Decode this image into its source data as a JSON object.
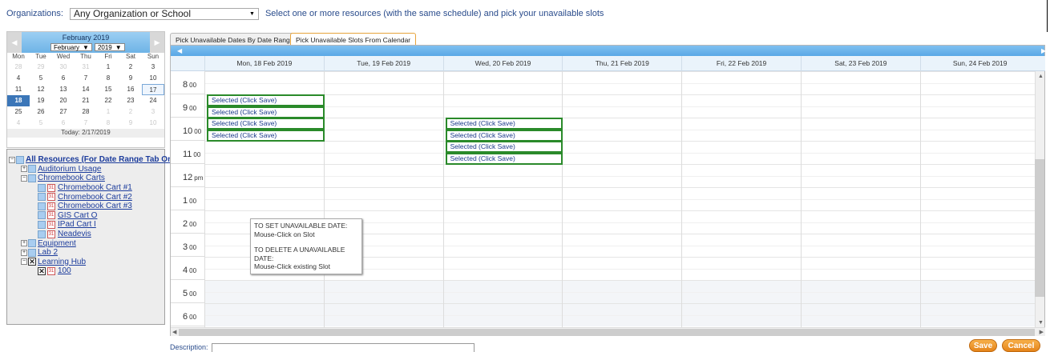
{
  "topbar": {
    "org_label": "Organizations:",
    "org_value": "Any Organization or School",
    "hint": "Select one or more resources (with the same schedule) and pick your unavailable slots"
  },
  "minical": {
    "title": "February 2019",
    "month_select": "February",
    "year_select": "2019",
    "dow": [
      "Mon",
      "Tue",
      "Wed",
      "Thu",
      "Fri",
      "Sat",
      "Sun"
    ],
    "weeks": [
      [
        "28",
        "29",
        "30",
        "31",
        "1",
        "2",
        "3"
      ],
      [
        "4",
        "5",
        "6",
        "7",
        "8",
        "9",
        "10"
      ],
      [
        "11",
        "12",
        "13",
        "14",
        "15",
        "16",
        "17"
      ],
      [
        "18",
        "19",
        "20",
        "21",
        "22",
        "23",
        "24"
      ],
      [
        "25",
        "26",
        "27",
        "28",
        "1",
        "2",
        "3"
      ],
      [
        "4",
        "5",
        "6",
        "7",
        "8",
        "9",
        "10"
      ]
    ],
    "today_label": "Today: 2/17/2019"
  },
  "tree": {
    "root": "All Resources (For Date Range Tab Only)",
    "groups": [
      {
        "label": "Auditorium Usage",
        "expanded": false,
        "checked": false,
        "items": []
      },
      {
        "label": "Chromebook Carts",
        "expanded": true,
        "checked": false,
        "items": [
          "Chromebook Cart #1",
          "Chromebook Cart #2",
          "Chromebook Cart #3",
          "GIS Cart O",
          "IPad Cart I",
          "Neadevis"
        ]
      },
      {
        "label": "Equipment",
        "expanded": false,
        "checked": false,
        "items": []
      },
      {
        "label": "Lab 2",
        "expanded": false,
        "checked": false,
        "items": []
      },
      {
        "label": "Learning Hub",
        "expanded": true,
        "checked": true,
        "items": [
          "100"
        ]
      }
    ]
  },
  "tabs": {
    "date_range": "Pick Unavailable Dates By Date Range",
    "calendar": "Pick Unavailable Slots From Calendar"
  },
  "scheduler": {
    "days": [
      "Mon, 18 Feb 2019",
      "Tue, 19 Feb 2019",
      "Wed, 20 Feb 2019",
      "Thu, 21 Feb 2019",
      "Fri, 22 Feb 2019",
      "Sat, 23 Feb 2019",
      "Sun, 24 Feb 2019"
    ],
    "hours": [
      {
        "h": "8",
        "s": "00"
      },
      {
        "h": "9",
        "s": "00"
      },
      {
        "h": "10",
        "s": "00"
      },
      {
        "h": "11",
        "s": "00"
      },
      {
        "h": "12",
        "s": "pm"
      },
      {
        "h": "1",
        "s": "00"
      },
      {
        "h": "2",
        "s": "00"
      },
      {
        "h": "3",
        "s": "00"
      },
      {
        "h": "4",
        "s": "00"
      },
      {
        "h": "5",
        "s": "00"
      },
      {
        "h": "6",
        "s": "00"
      }
    ],
    "events": [
      {
        "day": 0,
        "slot": 2,
        "label": "Selected (Click Save)"
      },
      {
        "day": 0,
        "slot": 3,
        "label": "Selected (Click Save)"
      },
      {
        "day": 0,
        "slot": 4,
        "label": "Selected (Click Save)"
      },
      {
        "day": 0,
        "slot": 5,
        "label": "Selected (Click Save)"
      },
      {
        "day": 2,
        "slot": 4,
        "label": "Selected (Click Save)"
      },
      {
        "day": 2,
        "slot": 5,
        "label": "Selected (Click Save)"
      },
      {
        "day": 2,
        "slot": 6,
        "label": "Selected (Click Save)"
      },
      {
        "day": 2,
        "slot": 7,
        "label": "Selected (Click Save)"
      }
    ],
    "tooltip": {
      "line1": "TO SET UNAVAILABLE DATE:",
      "line2": "Mouse-Click on Slot",
      "line3": "TO DELETE A UNAVAILABLE DATE:",
      "line4": "Mouse-Click existing Slot"
    }
  },
  "footer": {
    "desc_label": "Description:",
    "desc_value": "",
    "save": "Save",
    "cancel": "Cancel"
  },
  "colors": {
    "accent": "#5aa8e6",
    "event_border": "#2a8a2a",
    "button": "#e5841a"
  }
}
